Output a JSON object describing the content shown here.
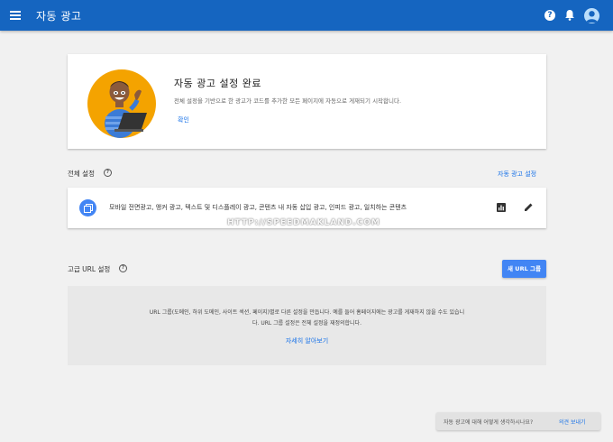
{
  "header": {
    "title": "자동 광고",
    "menu_icon": "menu-icon",
    "help_icon_glyph": "?",
    "colors": {
      "bar": "#1565c0"
    }
  },
  "hero": {
    "title": "자동 광고 설정 완료",
    "description": "전체 설정을 기반으로 한 광고가 코드를 추가한 모든 페이지에 자동으로 게재되기 시작합니다.",
    "confirm_label": "확인",
    "illustration": "person-with-laptop"
  },
  "overall_settings": {
    "title": "전체 설정",
    "help_glyph": "?",
    "action_label": "자동 광고 설정",
    "summary": "모바일 전면광고, 앵커 광고, 텍스트 및 디스플레이 광고, 콘텐츠 내 자동 삽입 광고, 인피드 광고, 일치하는 콘텐츠"
  },
  "watermark": "HTTP://SPEEDMAKLAND.COM",
  "advanced_url": {
    "title": "고급 URL 설정",
    "help_glyph": "?",
    "new_group_label": "새 URL 그룹",
    "empty_line1": "URL 그룹(도메인, 하위 도메인, 사이트 섹션, 페이지)별로 다른 설정을 만듭니다. 예를 들어 홈페이지에는 광고를 게재하지 않을 수도 있습니",
    "empty_line2": "다. URL 그룹 설정은 전체 설정을 재정의합니다.",
    "learn_more_label": "자세히 알아보기"
  },
  "feedback": {
    "question": "자동 광고에 대해 어떻게 생각하시나요?",
    "send_label": "의견 보내기"
  }
}
